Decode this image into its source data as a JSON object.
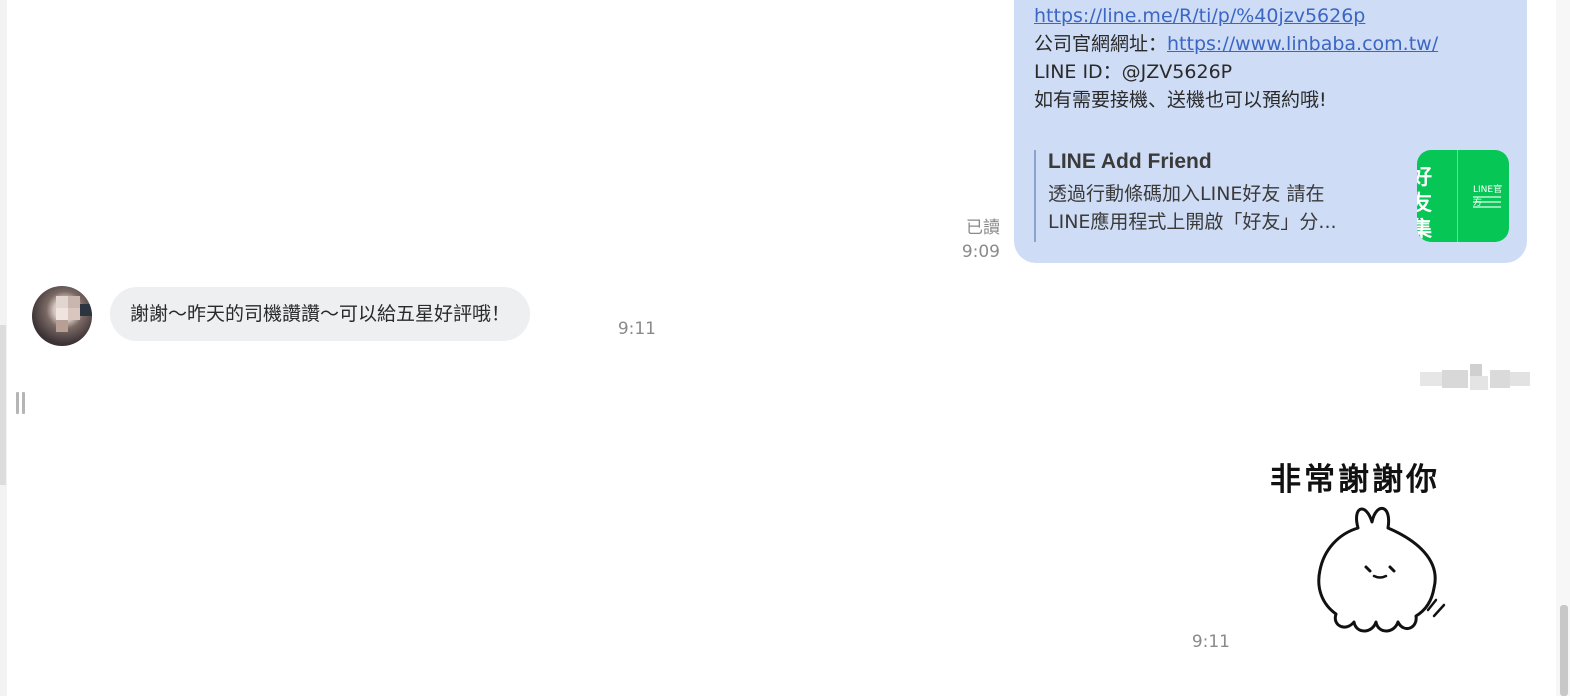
{
  "outgoing_message": {
    "link_line": "https://line.me/R/ti/p/%40jzv5626p",
    "website_label": "公司官網網址：",
    "website_link": "https://www.linbaba.com.tw/",
    "line_id": "LINE ID：@JZV5626P",
    "note": "如有需要接機、送機也可以預約哦!",
    "preview": {
      "title": "LINE Add Friend",
      "desc_line1": "透過行動條碼加入LINE好友 請在",
      "desc_line2": "LINE應用程式上開啟「好友」分...",
      "thumb_big_text": "好友集中",
      "thumb_small_text": "LINE官方"
    },
    "read_label": "已讀",
    "time": "9:09"
  },
  "incoming_message": {
    "text": "謝謝～昨天的司機讚讚～可以給五星好評哦！",
    "time": "9:11"
  },
  "sticker_message": {
    "text": "非常謝謝你",
    "time": "9:11"
  },
  "icons": {
    "avatar": "user-avatar-icon",
    "drag": "drag-handle-icon"
  }
}
